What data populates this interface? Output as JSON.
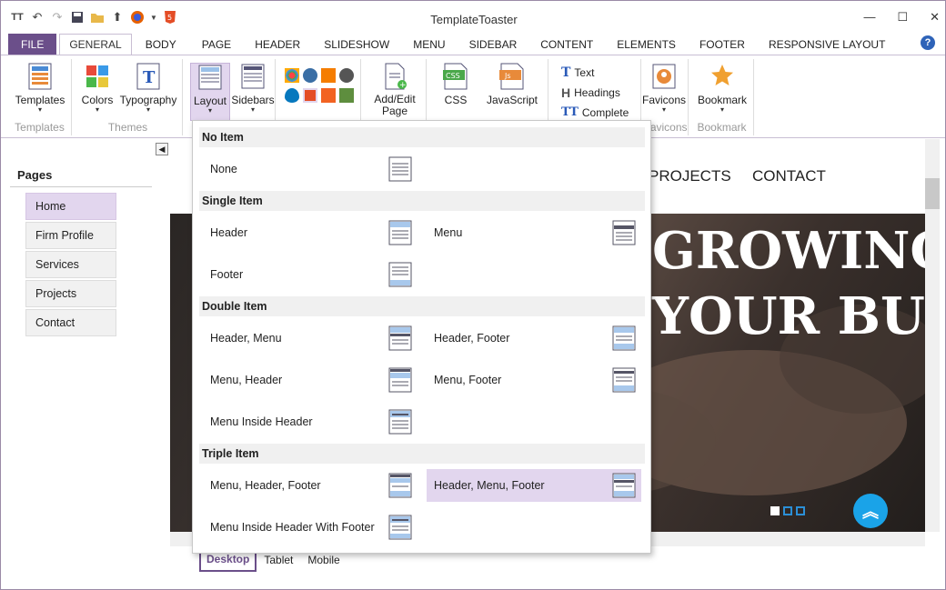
{
  "window": {
    "title": "TemplateToaster"
  },
  "tabs": [
    "FILE",
    "GENERAL",
    "BODY",
    "PAGE",
    "HEADER",
    "SLIDESHOW",
    "MENU",
    "SIDEBAR",
    "CONTENT",
    "ELEMENTS",
    "FOOTER",
    "RESPONSIVE LAYOUT"
  ],
  "ribbon": {
    "templates": {
      "btn": "Templates",
      "group": "Templates"
    },
    "themes": {
      "colors": "Colors",
      "typography": "Typography",
      "group": "Themes"
    },
    "layout": {
      "layout": "Layout",
      "sidebars": "Sidebars"
    },
    "page": {
      "btn": "Add/Edit Page"
    },
    "code": {
      "css": "CSS",
      "js": "JavaScript"
    },
    "text": {
      "text": "Text",
      "headings": "Headings",
      "complete": "Complete"
    },
    "favicons": {
      "btn": "Favicons",
      "group": "Favicons"
    },
    "bookmark": {
      "btn": "Bookmark",
      "group": "Bookmark"
    }
  },
  "sidebar": {
    "title": "Pages",
    "items": [
      "Home",
      "Firm Profile",
      "Services",
      "Projects",
      "Contact"
    ]
  },
  "preview": {
    "nav": [
      "PROJECTS",
      "CONTACT"
    ],
    "hero_line1": "GROWING A",
    "hero_line2": "YOUR BUSIN"
  },
  "device_tabs": [
    "Desktop",
    "Tablet",
    "Mobile"
  ],
  "layout_menu": {
    "no_item": {
      "title": "No Item",
      "options": [
        "None"
      ]
    },
    "single_item": {
      "title": "Single Item",
      "options": [
        "Header",
        "Menu",
        "Footer"
      ]
    },
    "double_item": {
      "title": "Double Item",
      "options": [
        "Header, Menu",
        "Header, Footer",
        "Menu, Header",
        "Menu, Footer",
        "Menu Inside Header"
      ]
    },
    "triple_item": {
      "title": "Triple Item",
      "options": [
        "Menu, Header, Footer",
        "Header, Menu, Footer",
        "Menu Inside Header With Footer"
      ]
    },
    "selected": "Header, Menu, Footer"
  },
  "colors": {
    "accent": "#6b4f8a",
    "selection": "#e2d6ee",
    "scroll_button": "#1aa3e8"
  }
}
